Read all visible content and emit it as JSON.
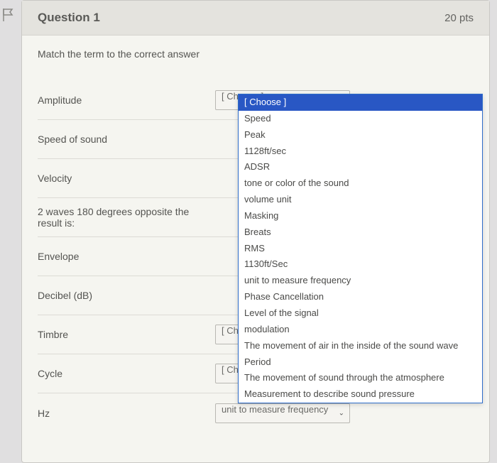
{
  "header": {
    "title": "Question 1",
    "points": "20 pts"
  },
  "instruction": "Match the term to the correct answer",
  "choose_placeholder": "[ Choose ]",
  "terms": [
    {
      "label": "Amplitude",
      "value": "[ Choose ]"
    },
    {
      "label": "Speed of sound",
      "value": ""
    },
    {
      "label": "Velocity",
      "value": ""
    },
    {
      "label": "2 waves 180 degrees opposite the result is:",
      "value": ""
    },
    {
      "label": "Envelope",
      "value": ""
    },
    {
      "label": "Decibel (dB)",
      "value": ""
    },
    {
      "label": "Timbre",
      "value": "[ Choose ]"
    },
    {
      "label": "Cycle",
      "value": "[ Choose ]"
    },
    {
      "label": "Hz",
      "value": "unit to measure frequency"
    }
  ],
  "dropdown_options": [
    "[ Choose ]",
    "Speed",
    "Peak",
    "1128ft/sec",
    "ADSR",
    "tone or color of the sound",
    "volume unit",
    "Masking",
    "Breats",
    "RMS",
    "1130ft/Sec",
    "unit to measure frequency",
    "Phase Cancellation",
    "Level of the signal",
    "modulation",
    "The movement of air in the inside of the sound wave",
    "Period",
    "The movement of sound through the atmosphere",
    "Measurement to describe sound pressure"
  ]
}
